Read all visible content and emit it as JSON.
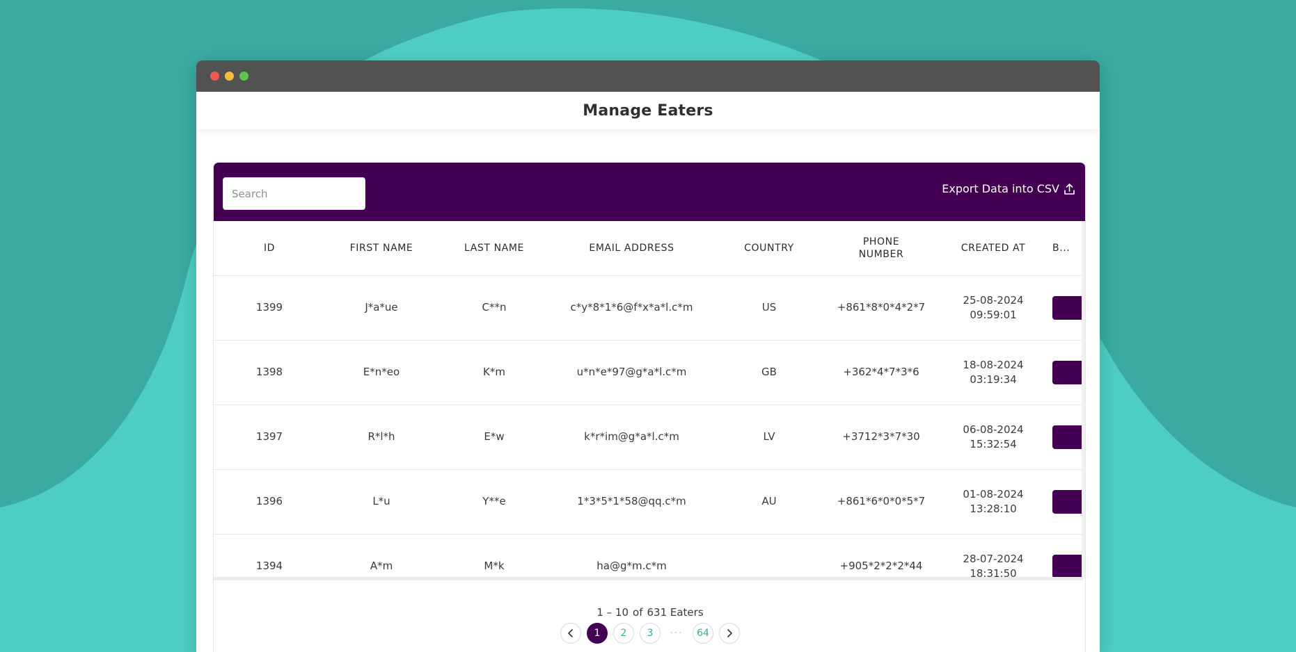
{
  "window": {
    "title": "Manage Eaters"
  },
  "toolbar": {
    "search_placeholder": "Search",
    "export_label": "Export Data into CSV"
  },
  "colors": {
    "brand": "#430052",
    "accent": "#3aaaa2",
    "background": "#3aaaa2"
  },
  "icons": {
    "export": "upload-icon",
    "prev": "chevron-left-icon",
    "next": "chevron-right-icon"
  },
  "table": {
    "columns": [
      "ID",
      "FIRST NAME",
      "LAST NAME",
      "EMAIL ADDRESS",
      "COUNTRY",
      "PHONE NUMBER",
      "CREATED AT",
      "B..."
    ],
    "rows": [
      {
        "id": "1399",
        "first": "J*a*ue",
        "last": "C**n",
        "email": "c*y*8*1*6@f*x*a*l.c*m",
        "country": "US",
        "phone": "+861*8*0*4*2*7",
        "date": "25-08-2024",
        "time": "09:59:01"
      },
      {
        "id": "1398",
        "first": "E*n*eo",
        "last": "K*m",
        "email": "u*n*e*97@g*a*l.c*m",
        "country": "GB",
        "phone": "+362*4*7*3*6",
        "date": "18-08-2024",
        "time": "03:19:34"
      },
      {
        "id": "1397",
        "first": "R*l*h",
        "last": "E*w",
        "email": "k*r*im@g*a*l.c*m",
        "country": "LV",
        "phone": "+3712*3*7*30",
        "date": "06-08-2024",
        "time": "15:32:54"
      },
      {
        "id": "1396",
        "first": "L*u",
        "last": "Y**e",
        "email": "1*3*5*1*58@qq.c*m",
        "country": "AU",
        "phone": "+861*6*0*0*5*7",
        "date": "01-08-2024",
        "time": "13:28:10"
      },
      {
        "id": "1394",
        "first": "A*m",
        "last": "M*k",
        "email": "ha@g*m.c*m",
        "country": "",
        "phone": "+905*2*2*2*44",
        "date": "28-07-2024",
        "time": "18:31:50"
      }
    ]
  },
  "pagination": {
    "range": "1 – 10",
    "of": "of",
    "total": "631 Eaters",
    "pages": [
      "1",
      "2",
      "3"
    ],
    "last_page": "64",
    "current": "1"
  }
}
